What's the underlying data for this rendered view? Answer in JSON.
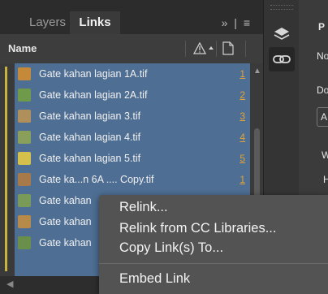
{
  "tabs": [
    {
      "label": "Layers",
      "active": false
    },
    {
      "label": "Links",
      "active": true
    }
  ],
  "tab_actions": "» | ≡",
  "column_header": {
    "name": "Name"
  },
  "links": [
    {
      "name": "Gate kahan lagian 1A.tif",
      "page": "1",
      "thumb_color": "#c48a3a"
    },
    {
      "name": "Gate kahan lagian 2A.tif",
      "page": "2",
      "thumb_color": "#6f9a4a"
    },
    {
      "name": "Gate kahan lagian 3.tif",
      "page": "3",
      "thumb_color": "#b0905a"
    },
    {
      "name": "Gate kahan lagian 4.tif",
      "page": "4",
      "thumb_color": "#8aa05a"
    },
    {
      "name": "Gate kahan lagian 5.tif",
      "page": "5",
      "thumb_color": "#d4c04a"
    },
    {
      "name": "Gate ka...n 6A .... Copy.tif",
      "page": "1",
      "thumb_color": "#a87a4a"
    },
    {
      "name": "Gate kahan",
      "page": "",
      "thumb_color": "#7a9a5a"
    },
    {
      "name": "Gate kahan",
      "page": "",
      "thumb_color": "#b88a4a"
    },
    {
      "name": "Gate kahan",
      "page": "",
      "thumb_color": "#6a8f4a"
    }
  ],
  "side_panel": {
    "labels": [
      "P",
      "No",
      "Do",
      "A",
      "W",
      "H"
    ]
  },
  "context_menu": {
    "items": [
      "Relink...",
      "Relink from CC Libraries...",
      "Copy Link(s) To...",
      "Embed Link"
    ]
  },
  "colors": {
    "selection": "#4e6e93",
    "page_number": "#e0a33a",
    "menu_bg": "#535353",
    "panel_bg": "#3a3a3a"
  }
}
